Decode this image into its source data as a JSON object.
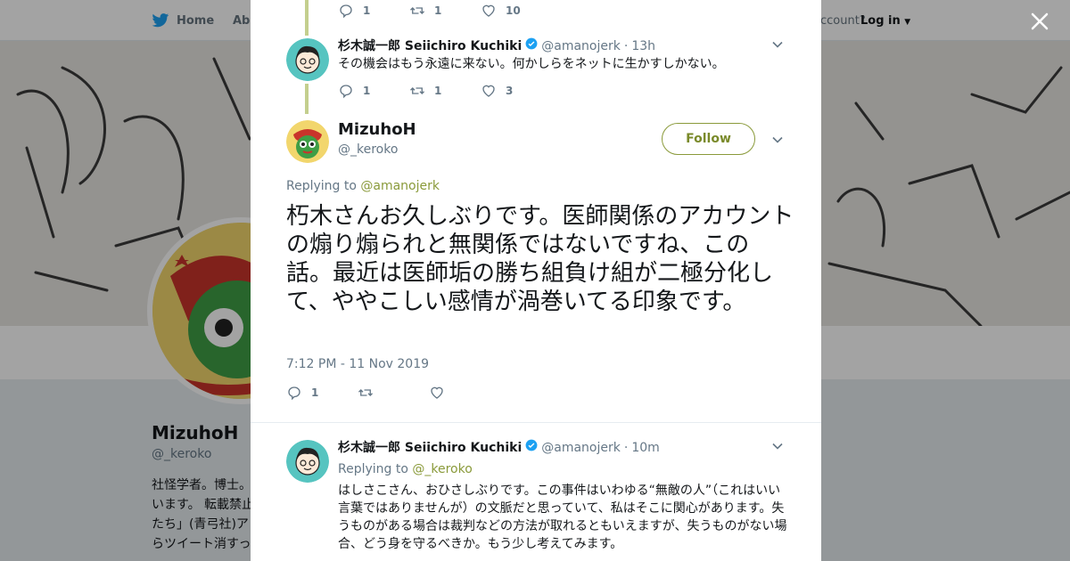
{
  "background": {
    "nav": {
      "home_label": "Home",
      "about_label": "Abo",
      "account_text": "ccount?",
      "login_label": "Log in"
    },
    "profile": {
      "name": "MizuhoH",
      "handle": "@_keroko",
      "bio": "社怪学者。博士。\nいます。 転載禁止\nたち」(青弓社)ア\nらツイート消すっ"
    }
  },
  "tweets": {
    "top_actions": {
      "replies": "1",
      "retweets": "1",
      "likes": "10"
    },
    "t1": {
      "fullname": "杉木誠一郎 Seiichiro Kuchiki",
      "handle": "@amanojerk",
      "time": "13h",
      "text": "その機会はもう永遠に来ない。何かしらをネットに生かすしかない。",
      "replies": "1",
      "retweets": "1",
      "likes": "3"
    },
    "main": {
      "name": "MizuhoH",
      "handle": "@_keroko",
      "follow_label": "Follow",
      "replying_prefix": "Replying to",
      "replying_to": "@amanojerk",
      "text": "朽木さんお久しぶりです。医師関係のアカウントの煽り煽られと無関係ではないですね、この話。最近は医師垢の勝ち組負け組が二極分化して、ややこしい感情が渦巻いてる印象です。",
      "timestamp": "7:12 PM - 11 Nov 2019",
      "replies": "1"
    },
    "t2": {
      "fullname": "杉木誠一郎 Seiichiro Kuchiki",
      "handle": "@amanojerk",
      "time": "10m",
      "replying_prefix": "Replying to",
      "replying_to": "@_keroko",
      "text": "はしさこさん、おひさしぶりです。この事件はいわゆる“無敵の人”（これはいい言葉ではありませんが）の文脈だと思っていて、私はそこに関心があります。失うものがある場合は裁判などの方法が取れるともいえますが、失うものがない場合、どう身を守るべきか。もう少し考えてみます。"
    }
  },
  "colors": {
    "accent": "#8a9a3a",
    "verified": "#1da1f2",
    "thread_line": "#c4cf8e"
  }
}
